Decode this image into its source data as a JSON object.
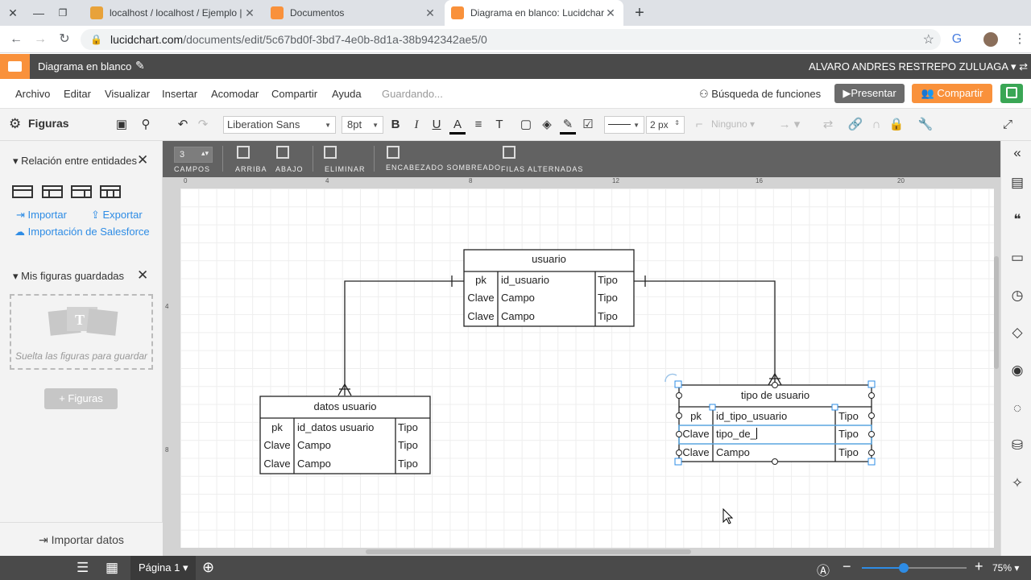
{
  "browser": {
    "tabs": [
      {
        "title": "localhost / localhost / Ejemplo |",
        "fav_color": "#e8a23a"
      },
      {
        "title": "Documentos",
        "fav_color": "#f9913b"
      },
      {
        "title": "Diagrama en blanco: Lucidchar",
        "fav_color": "#f9913b"
      }
    ],
    "url_host": "lucidchart.com",
    "url_path": "/documents/edit/5c67bd0f-3bd7-4e0b-8d1a-38b942342ae5/0"
  },
  "app": {
    "doc_title": "Diagrama en blanco",
    "user_name": "ALVARO ANDRES RESTREPO ZULUAGA",
    "brand_color": "#f9913b"
  },
  "menu": {
    "items": [
      "Archivo",
      "Editar",
      "Visualizar",
      "Insertar",
      "Acomodar",
      "Compartir",
      "Ayuda"
    ],
    "saving": "Guardando...",
    "feature_search": "Búsqueda de funciones",
    "present": "Presentar",
    "share": "Compartir"
  },
  "toolbar": {
    "panel_title": "Figuras",
    "font": "Liberation Sans",
    "font_size": "8pt",
    "line_width": "2 px",
    "arrow_none": "Ninguno"
  },
  "sidebar": {
    "section1": "Relación entre entidades",
    "import": "Importar",
    "export": "Exportar",
    "salesforce": "Importación de Salesforce",
    "section2": "Mis figuras guardadas",
    "drop_hint": "Suelta las figuras para guardar",
    "add_shapes": "Figuras",
    "import_data": "Importar datos"
  },
  "context_bar": {
    "field_count": "3",
    "fields_label": "CAMPOS",
    "up_label": "ARRIBA",
    "down_label": "ABAJO",
    "delete_label": "ELIMINAR",
    "shaded_header_label": "ENCABEZADO SOMBREADO",
    "alt_rows_label": "FILAS ALTERNADAS"
  },
  "ruler": [
    "0",
    "4",
    "8",
    "12",
    "16",
    "20"
  ],
  "ruler_left": [
    "4",
    "8"
  ],
  "entities": {
    "usuario": {
      "title": "usuario",
      "rows": [
        [
          "pk",
          "id_usuario",
          "Tipo"
        ],
        [
          "Clave",
          "Campo",
          "Tipo"
        ],
        [
          "Clave",
          "Campo",
          "Tipo"
        ]
      ]
    },
    "datos": {
      "title": "datos usuario",
      "rows": [
        [
          "pk",
          "id_datos usuario",
          "Tipo"
        ],
        [
          "Clave",
          "Campo",
          "Tipo"
        ],
        [
          "Clave",
          "Campo",
          "Tipo"
        ]
      ]
    },
    "tipo": {
      "title": "tipo de usuario",
      "rows": [
        [
          "pk",
          "id_tipo_usuario",
          "Tipo"
        ],
        [
          "Clave",
          "tipo_de_",
          "Tipo"
        ],
        [
          "Clave",
          "Campo",
          "Tipo"
        ]
      ]
    }
  },
  "bottom": {
    "page": "Página 1",
    "zoom": "75%",
    "zoom_fraction": 0.4
  }
}
